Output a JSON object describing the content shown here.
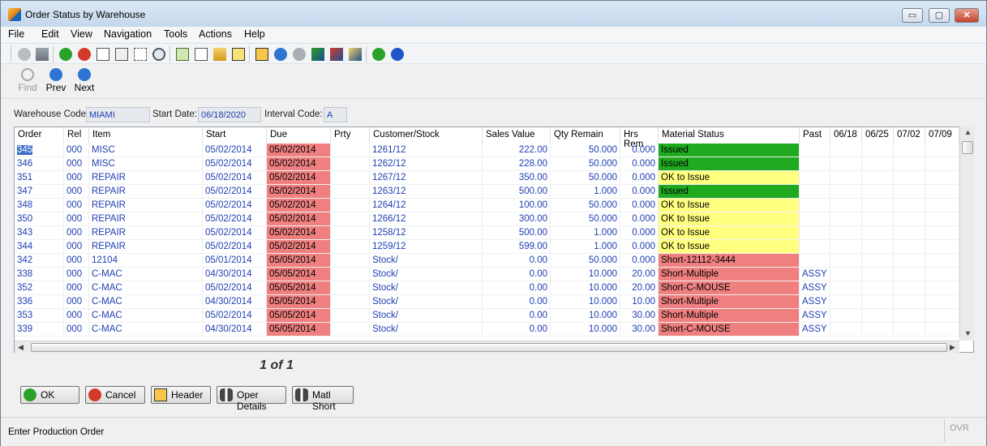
{
  "window": {
    "title": "Order Status by Warehouse",
    "min_label": "▭",
    "max_label": "▢",
    "close_label": "✕"
  },
  "menu": [
    "File",
    "Edit",
    "View",
    "Navigation",
    "Tools",
    "Actions",
    "Help"
  ],
  "navigation": {
    "find": "Find",
    "prev": "Prev",
    "next": "Next"
  },
  "criteria": {
    "warehouse_label": "Warehouse Code:",
    "warehouse_value": "MIAMI",
    "start_label": "Start Date:",
    "start_value": "06/18/2020",
    "interval_label": "Interval Code:",
    "interval_value": "A"
  },
  "columns": [
    "Order",
    "Rel",
    "Item",
    "Start",
    "Due",
    "Prty",
    "Customer/Stock",
    "Sales Value",
    "Qty Remain",
    "Hrs Rem",
    "Material Status",
    "Past",
    "06/18",
    "06/25",
    "07/02",
    "07/09"
  ],
  "rows": [
    {
      "order": "345",
      "rel": "000",
      "item": "MISC",
      "start": "05/02/2014",
      "due": "05/02/2014",
      "prty": "",
      "cust": "1261/12",
      "sales": "222.00",
      "qty": "50.000",
      "hrs": "0.000",
      "status": "Issued",
      "status_type": "issued",
      "past": ""
    },
    {
      "order": "346",
      "rel": "000",
      "item": "MISC",
      "start": "05/02/2014",
      "due": "05/02/2014",
      "prty": "",
      "cust": "1262/12",
      "sales": "228.00",
      "qty": "50.000",
      "hrs": "0.000",
      "status": "Issued",
      "status_type": "issued",
      "past": ""
    },
    {
      "order": "351",
      "rel": "000",
      "item": "REPAIR",
      "start": "05/02/2014",
      "due": "05/02/2014",
      "prty": "",
      "cust": "1267/12",
      "sales": "350.00",
      "qty": "50.000",
      "hrs": "0.000",
      "status": "OK to Issue",
      "status_type": "ok",
      "past": ""
    },
    {
      "order": "347",
      "rel": "000",
      "item": "REPAIR",
      "start": "05/02/2014",
      "due": "05/02/2014",
      "prty": "",
      "cust": "1263/12",
      "sales": "500.00",
      "qty": "1.000",
      "hrs": "0.000",
      "status": "Issued",
      "status_type": "issued",
      "past": ""
    },
    {
      "order": "348",
      "rel": "000",
      "item": "REPAIR",
      "start": "05/02/2014",
      "due": "05/02/2014",
      "prty": "",
      "cust": "1264/12",
      "sales": "100.00",
      "qty": "50.000",
      "hrs": "0.000",
      "status": "OK to Issue",
      "status_type": "ok",
      "past": ""
    },
    {
      "order": "350",
      "rel": "000",
      "item": "REPAIR",
      "start": "05/02/2014",
      "due": "05/02/2014",
      "prty": "",
      "cust": "1266/12",
      "sales": "300.00",
      "qty": "50.000",
      "hrs": "0.000",
      "status": "OK to Issue",
      "status_type": "ok",
      "past": ""
    },
    {
      "order": "343",
      "rel": "000",
      "item": "REPAIR",
      "start": "05/02/2014",
      "due": "05/02/2014",
      "prty": "",
      "cust": "1258/12",
      "sales": "500.00",
      "qty": "1.000",
      "hrs": "0.000",
      "status": "OK to Issue",
      "status_type": "ok",
      "past": ""
    },
    {
      "order": "344",
      "rel": "000",
      "item": "REPAIR",
      "start": "05/02/2014",
      "due": "05/02/2014",
      "prty": "",
      "cust": "1259/12",
      "sales": "599.00",
      "qty": "1.000",
      "hrs": "0.000",
      "status": "OK to Issue",
      "status_type": "ok",
      "past": ""
    },
    {
      "order": "342",
      "rel": "000",
      "item": "12104",
      "start": "05/01/2014",
      "due": "05/05/2014",
      "prty": "",
      "cust": "Stock/",
      "sales": "0.00",
      "qty": "50.000",
      "hrs": "0.000",
      "status": "Short-12112-3444",
      "status_type": "short",
      "past": ""
    },
    {
      "order": "338",
      "rel": "000",
      "item": "C-MAC",
      "start": "04/30/2014",
      "due": "05/05/2014",
      "prty": "",
      "cust": "Stock/",
      "sales": "0.00",
      "qty": "10.000",
      "hrs": "20.00",
      "status": "Short-Multiple",
      "status_type": "short",
      "past": "ASSY"
    },
    {
      "order": "352",
      "rel": "000",
      "item": "C-MAC",
      "start": "05/02/2014",
      "due": "05/05/2014",
      "prty": "",
      "cust": "Stock/",
      "sales": "0.00",
      "qty": "10.000",
      "hrs": "20.00",
      "status": "Short-C-MOUSE",
      "status_type": "short",
      "past": "ASSY"
    },
    {
      "order": "336",
      "rel": "000",
      "item": "C-MAC",
      "start": "04/30/2014",
      "due": "05/05/2014",
      "prty": "",
      "cust": "Stock/",
      "sales": "0.00",
      "qty": "10.000",
      "hrs": "10.00",
      "status": "Short-Multiple",
      "status_type": "short",
      "past": "ASSY"
    },
    {
      "order": "353",
      "rel": "000",
      "item": "C-MAC",
      "start": "05/02/2014",
      "due": "05/05/2014",
      "prty": "",
      "cust": "Stock/",
      "sales": "0.00",
      "qty": "10.000",
      "hrs": "30.00",
      "status": "Short-Multiple",
      "status_type": "short",
      "past": "ASSY"
    },
    {
      "order": "339",
      "rel": "000",
      "item": "C-MAC",
      "start": "04/30/2014",
      "due": "05/05/2014",
      "prty": "",
      "cust": "Stock/",
      "sales": "0.00",
      "qty": "10.000",
      "hrs": "30.00",
      "status": "Short-C-MOUSE",
      "status_type": "short",
      "past": "ASSY"
    }
  ],
  "colors": {
    "issued": "#1faa1f",
    "ok": "#ffff80",
    "short": "#f08080",
    "due": "#f08080",
    "link": "#1f3fb3"
  },
  "pager": {
    "text": "1 of 1"
  },
  "buttons": {
    "ok": "OK",
    "cancel": "Cancel",
    "header": "Header",
    "oper_details": "Oper Details",
    "matl_short": "Matl Short"
  },
  "status": {
    "text": "Enter Production Order",
    "mode": "OVR"
  }
}
